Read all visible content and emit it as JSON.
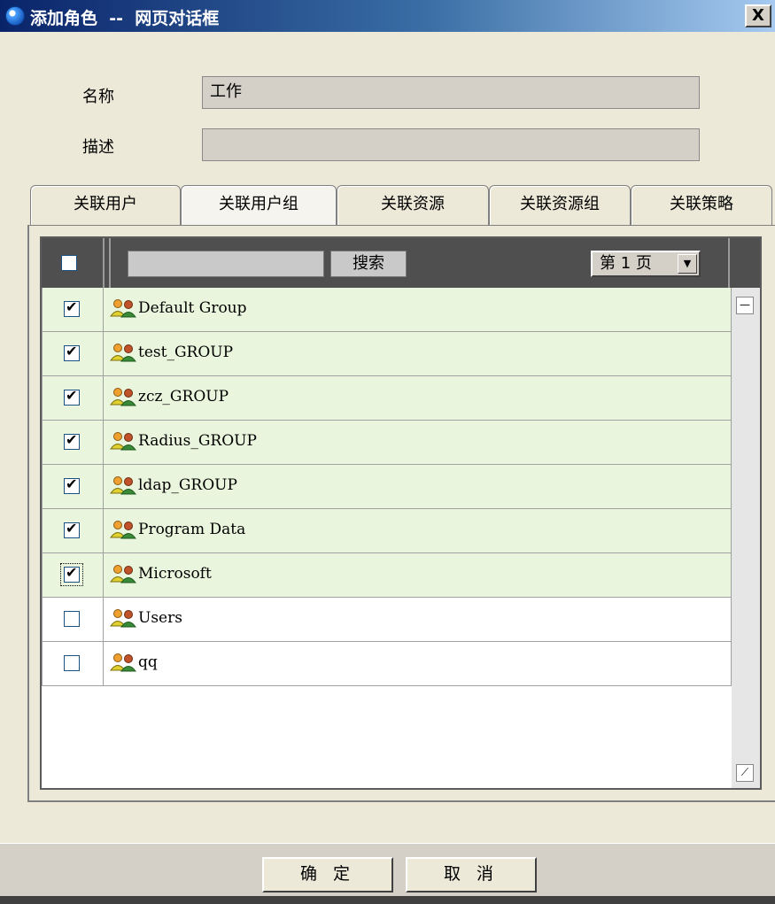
{
  "window": {
    "title": "添加角色  --  网页对话框",
    "close_label": "X"
  },
  "form": {
    "name_label": "名称",
    "name_value": "工作",
    "desc_label": "描述",
    "desc_value": ""
  },
  "tabs": [
    {
      "label": "关联用户"
    },
    {
      "label": "关联用户组"
    },
    {
      "label": "关联资源"
    },
    {
      "label": "关联资源组"
    },
    {
      "label": "关联策略"
    }
  ],
  "toolbar": {
    "search_value": "",
    "search_button": "搜索",
    "page_label": "第 1 页"
  },
  "groups": [
    {
      "name": "Default Group",
      "checked": true
    },
    {
      "name": "test_GROUP",
      "checked": true
    },
    {
      "name": "zcz_GROUP",
      "checked": true
    },
    {
      "name": "Radius_GROUP",
      "checked": true
    },
    {
      "name": "ldap_GROUP",
      "checked": true
    },
    {
      "name": "Program Data",
      "checked": true
    },
    {
      "name": "Microsoft",
      "checked": true
    },
    {
      "name": "Users",
      "checked": false
    },
    {
      "name": "qq",
      "checked": false
    }
  ],
  "footer": {
    "ok_label": "确 定",
    "cancel_label": "取 消"
  },
  "colors": {
    "checked_row": "#e9f5dc",
    "toolbar": "#4f4f4f",
    "titlebar_start": "#0a246a"
  }
}
